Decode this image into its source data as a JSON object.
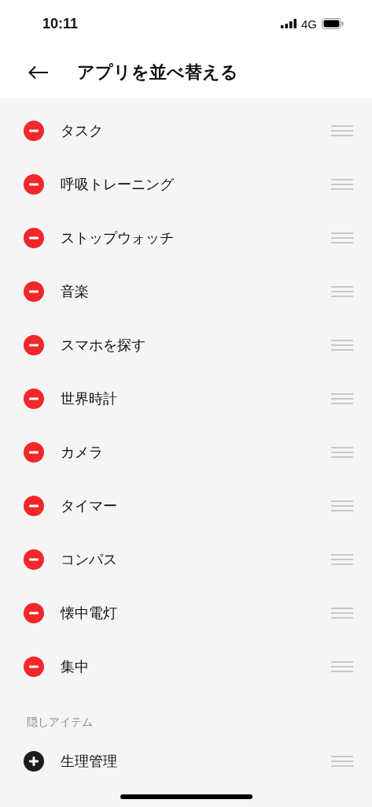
{
  "status_bar": {
    "time": "10:11",
    "network": "4G"
  },
  "header": {
    "title": "アプリを並べ替える"
  },
  "active_apps": [
    {
      "label": "タスク",
      "kind": "remove"
    },
    {
      "label": "呼吸トレーニング",
      "kind": "remove"
    },
    {
      "label": "ストップウォッチ",
      "kind": "remove"
    },
    {
      "label": "音楽",
      "kind": "remove"
    },
    {
      "label": "スマホを探す",
      "kind": "remove"
    },
    {
      "label": "世界時計",
      "kind": "remove"
    },
    {
      "label": "カメラ",
      "kind": "remove"
    },
    {
      "label": "タイマー",
      "kind": "remove"
    },
    {
      "label": "コンパス",
      "kind": "remove"
    },
    {
      "label": "懐中電灯",
      "kind": "remove"
    },
    {
      "label": "集中",
      "kind": "remove"
    }
  ],
  "hidden_section": {
    "title": "隠しアイテム",
    "apps": [
      {
        "label": "生理管理",
        "kind": "add"
      }
    ]
  }
}
